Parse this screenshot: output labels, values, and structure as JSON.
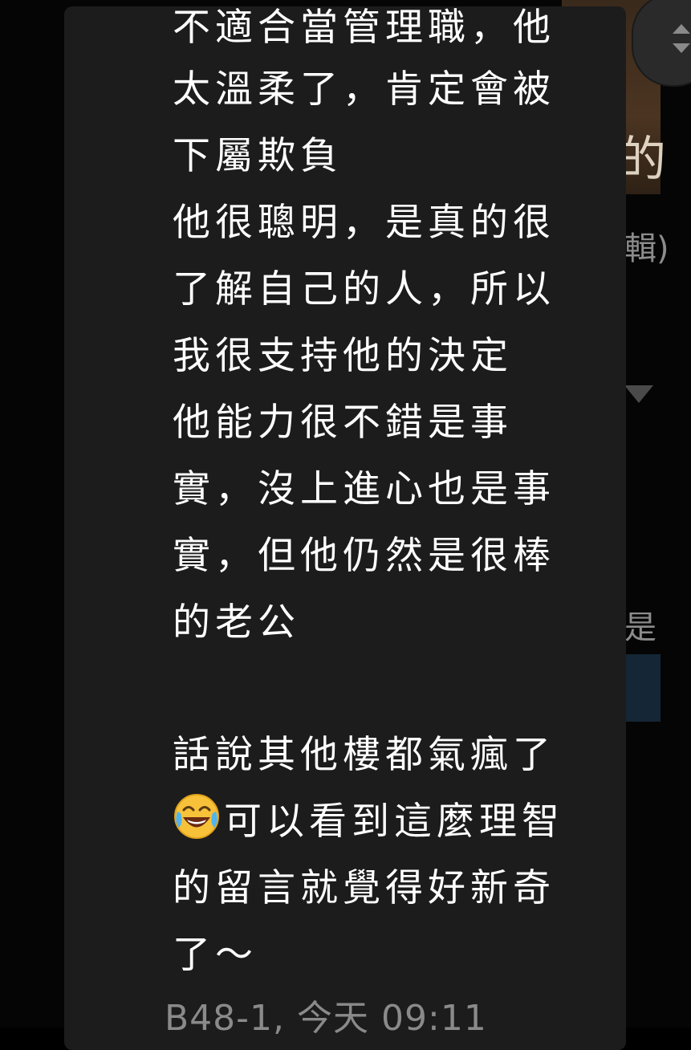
{
  "background": {
    "thumb_char": "的",
    "edit_text": "輯)",
    "side_char": "是"
  },
  "comment": {
    "lines": [
      "不適合當管理職，他",
      "太溫柔了，肯定會被",
      "下屬欺負",
      "他很聰明，是真的很",
      "了解自己的人，所以",
      "我很支持他的決定",
      "他能力很不錯是事",
      "實，沒上進心也是事",
      "實，但他仍然是很棒",
      "的老公"
    ],
    "lines_after": [
      "話說其他樓都氣瘋了",
      "可以看到這麼理智",
      "的留言就覺得好新奇",
      "了～"
    ],
    "emoji": "face-with-tears-of-joy",
    "floor": "B48-1",
    "time": "今天 09:11"
  },
  "colors": {
    "page": "#000000",
    "card": "#1c1c1c",
    "text": "#ffffff",
    "meta": "#8a8a8a"
  }
}
